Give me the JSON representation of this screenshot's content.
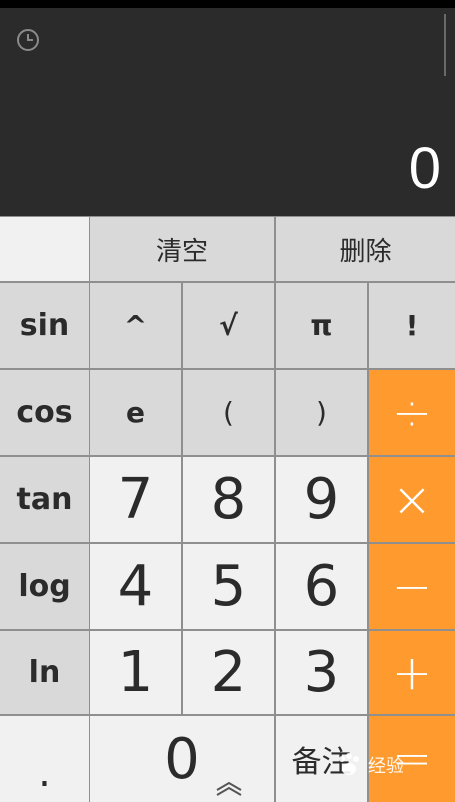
{
  "display": {
    "value": "0",
    "history_icon": "clock-icon"
  },
  "top_row": {
    "clear_label": "清空",
    "delete_label": "删除"
  },
  "functions": {
    "sin": "sin",
    "cos": "cos",
    "tan": "tan",
    "log": "log",
    "ln": "ln",
    "dot": "."
  },
  "symbols": {
    "power": "^",
    "sqrt": "√",
    "pi": "π",
    "factorial": "!",
    "e": "e",
    "lparen": "(",
    "rparen": ")"
  },
  "digits": {
    "d7": "7",
    "d8": "8",
    "d9": "9",
    "d4": "4",
    "d5": "5",
    "d6": "6",
    "d1": "1",
    "d2": "2",
    "d3": "3",
    "d0": "0"
  },
  "operators": {
    "divide": "÷",
    "multiply": "×",
    "minus": "−",
    "plus": "+",
    "equals": "="
  },
  "note_label": "备注",
  "watermark": "经验",
  "colors": {
    "display_bg": "#2b2b2b",
    "function_key": "#d9d9d9",
    "digit_key": "#f1f1f1",
    "operator_key": "#ff9a2e",
    "divider": "#8f8f8f"
  }
}
